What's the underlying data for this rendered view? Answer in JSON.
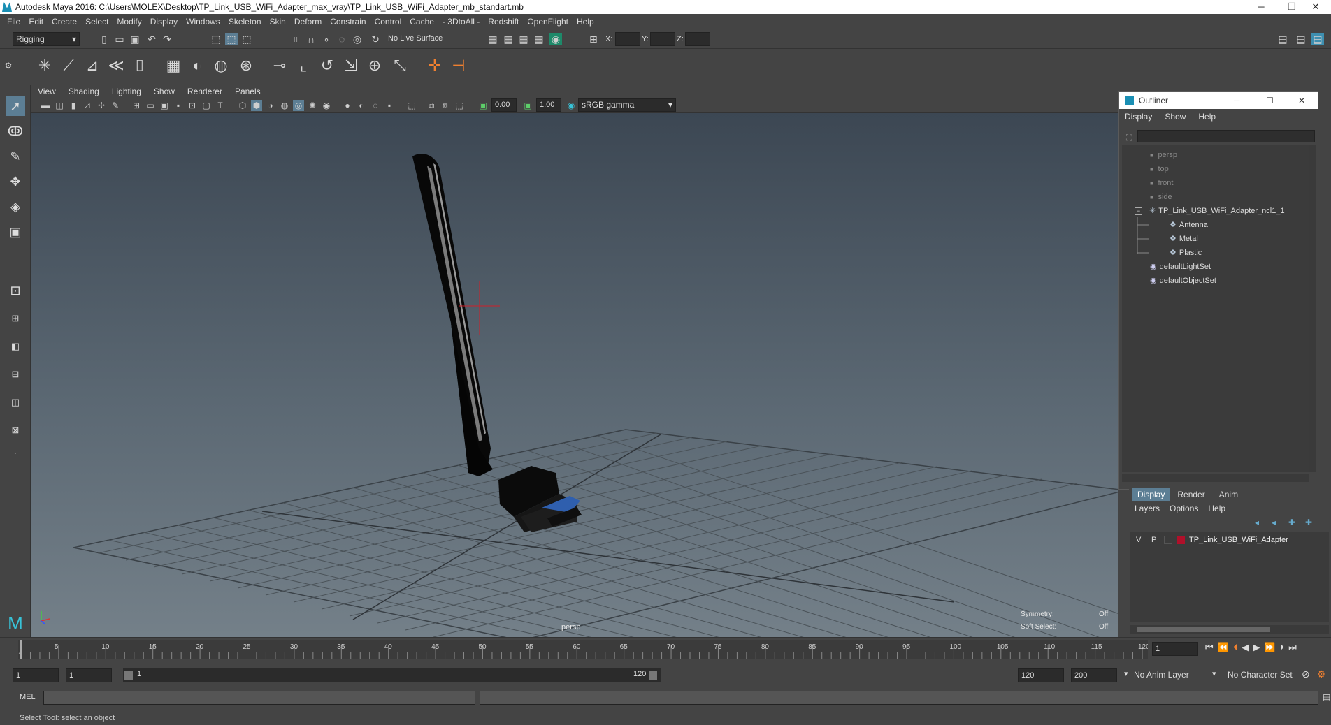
{
  "window": {
    "title": "Autodesk Maya 2016: C:\\Users\\MOLEX\\Desktop\\TP_Link_USB_WiFi_Adapter_max_vray\\TP_Link_USB_WiFi_Adapter_mb_standart.mb",
    "minimize": "─",
    "restore": "❐",
    "close": "✕"
  },
  "menubar": [
    "File",
    "Edit",
    "Create",
    "Select",
    "Modify",
    "Display",
    "Windows",
    "Skeleton",
    "Skin",
    "Deform",
    "Constrain",
    "Control",
    "Cache",
    "- 3DtoAll -",
    "Redshift",
    "OpenFlight",
    "Help"
  ],
  "statusline": {
    "menuset": "Rigging",
    "live_surface": "No Live Surface",
    "x_label": "X:",
    "y_label": "Y:",
    "z_label": "Z:"
  },
  "viewport": {
    "menu": [
      "View",
      "Shading",
      "Lighting",
      "Show",
      "Renderer",
      "Panels"
    ],
    "exposure": "0.00",
    "gamma": "1.00",
    "color_space": "sRGB gamma",
    "camera_label": "persp",
    "hud": {
      "symmetry_label": "Symmetry:",
      "symmetry_value": "Off",
      "soft_select_label": "Soft Select:",
      "soft_select_value": "Off"
    }
  },
  "outliner": {
    "title": "Outliner",
    "menu": [
      "Display",
      "Show",
      "Help"
    ],
    "items": [
      {
        "label": "persp",
        "dim": true
      },
      {
        "label": "top",
        "dim": true
      },
      {
        "label": "front",
        "dim": true
      },
      {
        "label": "side",
        "dim": true
      },
      {
        "label": "TP_Link_USB_WiFi_Adapter_ncl1_1",
        "dim": false
      },
      {
        "label": "Antenna",
        "dim": false
      },
      {
        "label": "Metal",
        "dim": false
      },
      {
        "label": "Plastic",
        "dim": false
      },
      {
        "label": "defaultLightSet",
        "dim": false
      },
      {
        "label": "defaultObjectSet",
        "dim": false
      }
    ]
  },
  "layers": {
    "tabs": [
      "Display",
      "Render",
      "Anim"
    ],
    "menu": [
      "Layers",
      "Options",
      "Help"
    ],
    "row": {
      "v": "V",
      "p": "P",
      "name": "TP_Link_USB_WiFi_Adapter",
      "color": "#b0102a"
    }
  },
  "timeslider": {
    "ticks": [
      "1",
      "5",
      "10",
      "15",
      "20",
      "25",
      "30",
      "35",
      "40",
      "45",
      "50",
      "55",
      "60",
      "65",
      "70",
      "75",
      "80",
      "85",
      "90",
      "95",
      "100",
      "105",
      "110",
      "115",
      "120"
    ],
    "current_frame": "1"
  },
  "range": {
    "start": "1",
    "playback_start": "1",
    "slider_start": "1",
    "slider_end": "120",
    "playback_end": "120",
    "end": "200",
    "anim_layer": "No Anim Layer",
    "character_set": "No Character Set"
  },
  "cmdline": {
    "label": "MEL"
  },
  "helpline": "Select Tool: select an object",
  "colors": {
    "accent": "#5ab9e6",
    "ui_bg": "#444444",
    "field_bg": "#2b2b2b",
    "highlight": "#3e8fb0"
  }
}
